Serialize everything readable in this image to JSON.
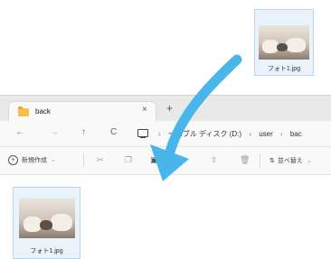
{
  "drag_file": {
    "label": "フォト1.jpg"
  },
  "window": {
    "tab": {
      "title": "back",
      "close_label": "×"
    },
    "new_tab_label": "+",
    "nav": {
      "back": "←",
      "forward": "→",
      "up": "↑",
      "refresh": "C"
    },
    "breadcrumb": {
      "items": [
        "›",
        "ーバブル ディスク (D:)",
        "›",
        "user",
        "›",
        "bac"
      ]
    },
    "toolbar": {
      "new_label": "新規作成",
      "new_chevron": "⌄",
      "sort_label": "並べ替え",
      "sort_chevron": "⌄"
    },
    "files": [
      {
        "label": "フォト1.jpg"
      }
    ]
  },
  "colors": {
    "arrow": "#48b6ea",
    "selection_bg": "#eaf3fc",
    "selection_border": "#b9d6f2",
    "folder": "#f2c04d"
  }
}
